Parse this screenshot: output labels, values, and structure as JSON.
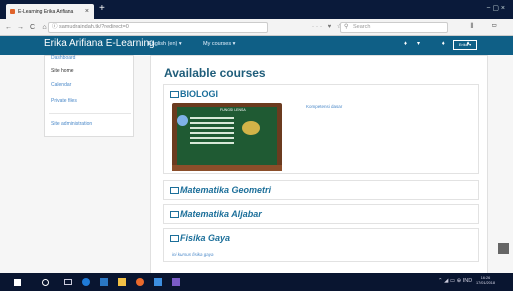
{
  "browser": {
    "tab_title": "E-Learning Erika Arifiana",
    "tab_close": "×",
    "new_tab": "+",
    "url": "samudraindah.tk/?redirect=0",
    "search_placeholder": "Search",
    "url_actions": "··· ♥ ☆",
    "tools": "⫴ ▭",
    "back": "←",
    "forward": "→",
    "reload": "C",
    "home": "⌂",
    "window_controls": "−  ▢  ×"
  },
  "moodle": {
    "site_name": "Erika Arifiana E-Learning",
    "language_menu": "English (en) ▾",
    "courses_menu": "My courses ▾",
    "header_icons": "♦▾ ♦ ♦",
    "user_menu": "Erika ▾",
    "brand_color": "#0f5f86"
  },
  "left_block": {
    "items": [
      "Dashboard",
      "Site home",
      "Calendar",
      "Private files",
      "Site administration"
    ]
  },
  "main": {
    "title": "Available courses",
    "courses": [
      {
        "name": "BIOLOGI",
        "summary": "Kompetensi dasar"
      },
      {
        "name": "Matematika Geometri"
      },
      {
        "name": "Matematika Aljabar"
      },
      {
        "name": "Fisika Gaya",
        "description": "ini kursus fisika gaya"
      }
    ],
    "board_heading": "FUNGSI LENSA"
  },
  "taskbar": {
    "tray": "⌃ ◢ ▭ ⊕ IND",
    "time": "16:26",
    "date": "17/01/2018"
  }
}
